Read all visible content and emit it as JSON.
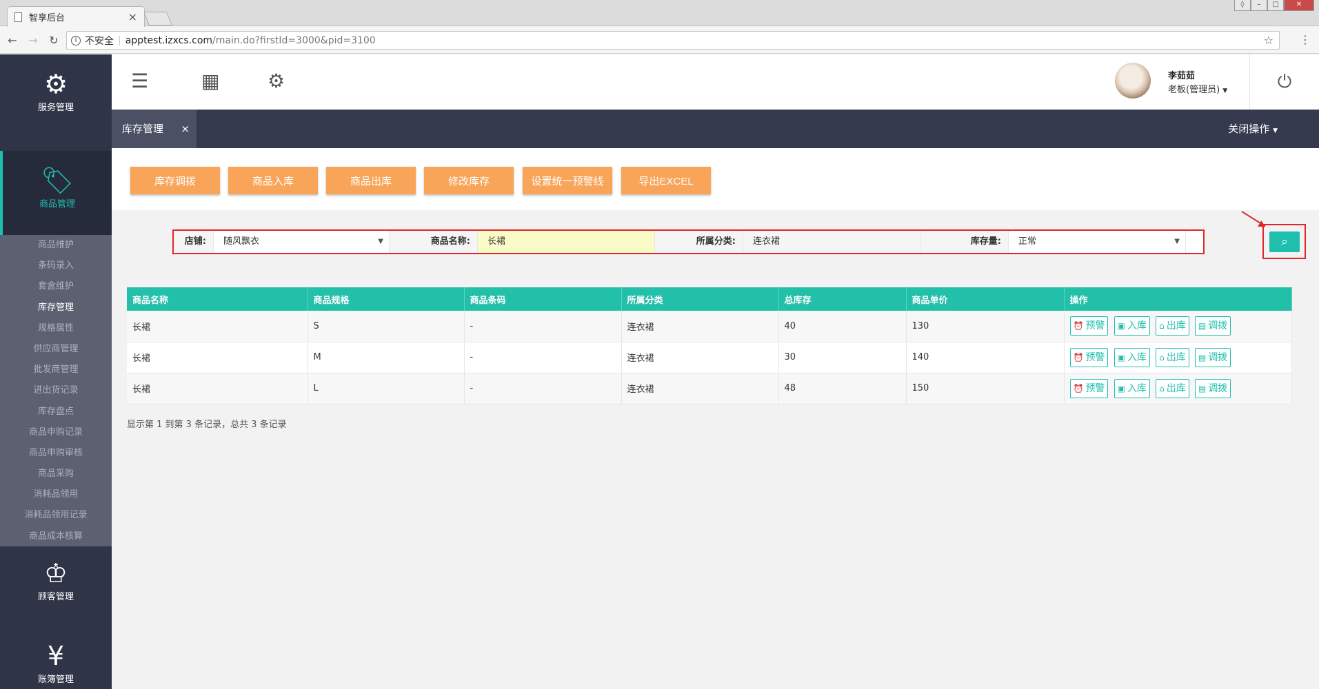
{
  "browser": {
    "tab_title": "智享后台",
    "insecure_label": "不安全",
    "url_host": "apptest.izxcs.com",
    "url_path": "/main.do?firstId=3000&pid=3100"
  },
  "sidebar": {
    "sections": [
      {
        "label": "服务管理",
        "icon": "hand-gear-icon"
      },
      {
        "label": "商品管理",
        "icon": "sale-tag-icon"
      },
      {
        "label": "顾客管理",
        "icon": "crown-icon"
      },
      {
        "label": "账簿管理",
        "icon": "ledger-icon"
      }
    ],
    "submenu": [
      "商品维护",
      "条码录入",
      "套盒维护",
      "库存管理",
      "规格属性",
      "供应商管理",
      "批发商管理",
      "进出货记录",
      "库存盘点",
      "商品申购记录",
      "商品申购审核",
      "商品采购",
      "消耗品领用",
      "消耗品领用记录",
      "商品成本核算"
    ]
  },
  "header": {
    "user_name": "李茹茹",
    "user_role": "老板(管理员)"
  },
  "tabs": {
    "current": "库存管理",
    "close_ops": "关闭操作"
  },
  "actions": [
    "库存调拨",
    "商品入库",
    "商品出库",
    "修改库存",
    "设置统一预警线",
    "导出EXCEL"
  ],
  "filter": {
    "store_label": "店铺:",
    "store_value": "随风飘衣",
    "name_label": "商品名称:",
    "name_value": "长裙",
    "category_label": "所属分类:",
    "category_value": "连衣裙",
    "stock_label": "库存量:",
    "stock_value": "正常"
  },
  "table": {
    "headers": [
      "商品名称",
      "商品规格",
      "商品条码",
      "所属分类",
      "总库存",
      "商品单价",
      "操作"
    ],
    "rows": [
      [
        "长裙",
        "S",
        "-",
        "连衣裙",
        "40",
        "130"
      ],
      [
        "长裙",
        "M",
        "-",
        "连衣裙",
        "30",
        "140"
      ],
      [
        "长裙",
        "L",
        "-",
        "连衣裙",
        "48",
        "150"
      ]
    ],
    "row_actions": [
      "预警",
      "入库",
      "出库",
      "调拨"
    ]
  },
  "footer": "显示第 1 到第 3 条记录，总共 3 条记录",
  "colors": {
    "accent": "#1fbfae",
    "orange": "#f8a55a",
    "sidebar": "#2f3447",
    "highlight_red": "#e0262c"
  }
}
